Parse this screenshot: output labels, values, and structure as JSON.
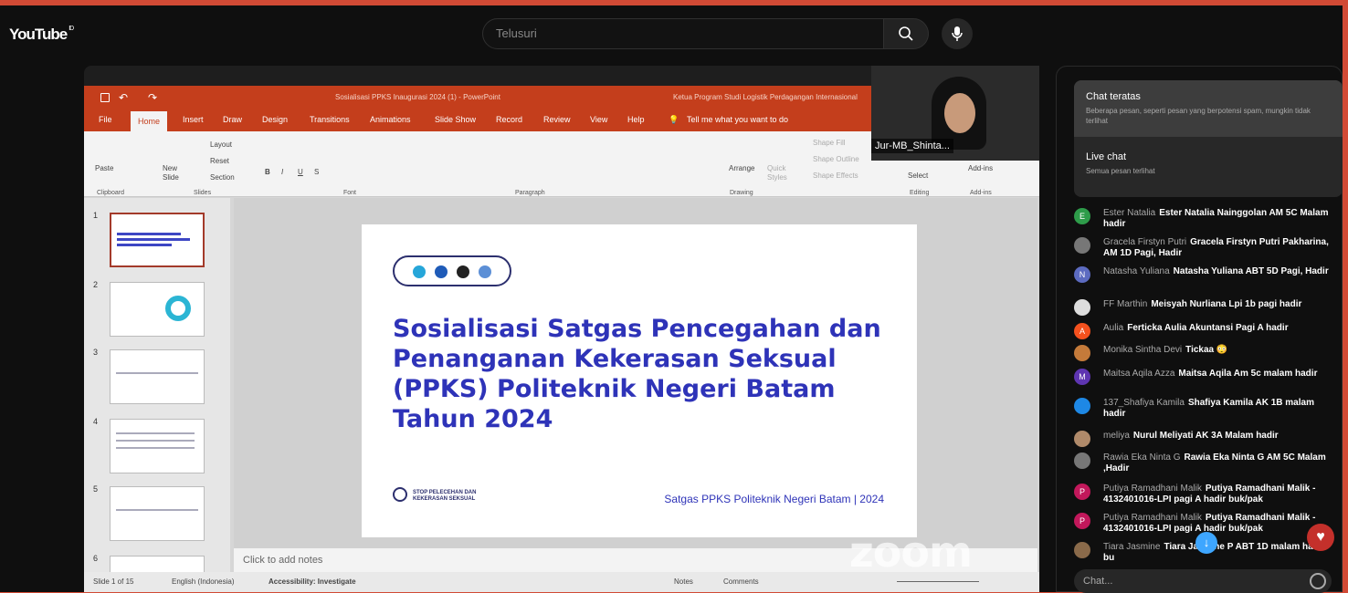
{
  "youtube": {
    "logo": "YouTube",
    "logo_mark": "ID",
    "search_placeholder": "Telusuri"
  },
  "ppt": {
    "title_doc": "Sosialisasi PPKS Inaugurasi 2024 (1)  -  PowerPoint",
    "title_user": "Ketua Program Studi Logistik Perdagangan Internasional",
    "tabs": [
      "File",
      "Home",
      "Insert",
      "Draw",
      "Design",
      "Transitions",
      "Animations",
      "Slide Show",
      "Record",
      "Review",
      "View",
      "Help"
    ],
    "tell_me": "Tell me what you want to do",
    "ribbon": {
      "clipboard": "Clipboard",
      "paste": "Paste",
      "slides": "Slides",
      "new_slide": "New Slide",
      "layout": "Layout",
      "reset": "Reset",
      "section": "Section",
      "font": "Font",
      "paragraph": "Paragraph",
      "drawing": "Drawing",
      "arrange": "Arrange",
      "quick_styles": "Quick Styles",
      "shape_fill": "Shape Fill",
      "shape_outline": "Shape Outline",
      "shape_effects": "Shape Effects",
      "editing": "Editing",
      "select": "Select",
      "addins": "Add-ins",
      "addins2": "Add-ins"
    },
    "thumb_numbers": [
      "1",
      "2",
      "3",
      "4",
      "5",
      "6"
    ],
    "slide": {
      "title": "Sosialisasi Satgas Pencegahan dan Penanganan Kekerasan Seksual (PPKS) Politeknik Negeri Batam Tahun 2024",
      "logo_text": "STOP PELECEHAN DAN KEKERASAN SEKSUAL",
      "footer": "Satgas PPKS Politeknik Negeri Batam | 2024"
    },
    "notes_placeholder": "Click to add notes",
    "status": {
      "slide_of": "Slide 1 of 15",
      "language": "English (Indonesia)",
      "accessibility": "Accessibility: Investigate",
      "notes": "Notes",
      "comments": "Comments"
    }
  },
  "camera": {
    "name": "Jur-MB_Shinta..."
  },
  "zoom_watermark": "zoom",
  "chat": {
    "menu": [
      {
        "title": "Chat teratas",
        "subtitle": "Beberapa pesan, seperti pesan yang berpotensi spam, mungkin tidak terlihat"
      },
      {
        "title": "Live chat",
        "subtitle": "Semua pesan terlihat"
      }
    ],
    "messages": [
      {
        "author": "Ester Natalia",
        "text": "Ester Natalia Nainggolan AM 5C Malam hadir",
        "avatar": "E",
        "color": "#2e9c4a"
      },
      {
        "author": "Gracela Firstyn Putri",
        "text": "Gracela Firstyn Putri Pakharina, AM 1D Pagi, Hadir",
        "avatar": "",
        "color": "#777"
      },
      {
        "author": "Natasha Yuliana",
        "text": "Natasha Yuliana ABT 5D Pagi, Hadir",
        "avatar": "N",
        "color": "#5c6bc0"
      },
      {
        "author": "FF Marthin",
        "text": "Meisyah Nurliana Lpi 1b pagi hadir",
        "avatar": "",
        "color": "#ddd"
      },
      {
        "author": "Aulia",
        "text": "Ferticka Aulia Akuntansi Pagi A hadir",
        "avatar": "A",
        "color": "#f4511e"
      },
      {
        "author": "Monika Sintha Devi",
        "text": "Tickaa 😳",
        "avatar": "",
        "color": "#c47a3a"
      },
      {
        "author": "Maitsa Aqila Azza",
        "text": "Maitsa Aqila Am 5c malam hadir",
        "avatar": "M",
        "color": "#5e35b1"
      },
      {
        "author": "137_Shafiya Kamila",
        "text": "Shafiya Kamila AK 1B malam hadir",
        "avatar": "",
        "color": "#1e88e5"
      },
      {
        "author": "meliya",
        "text": "Nurul Meliyati AK 3A Malam hadir",
        "avatar": "",
        "color": "#b08a6a"
      },
      {
        "author": "Rawia Eka Ninta G",
        "text": "Rawia Eka Ninta G AM 5C Malam ,Hadir",
        "avatar": "",
        "color": "#777"
      },
      {
        "author": "Putiya Ramadhani Malik",
        "text": "Putiya Ramadhani Malik - 4132401016-LPI pagi A hadir buk/pak",
        "avatar": "P",
        "color": "#c2185b"
      },
      {
        "author": "Putiya Ramadhani Malik",
        "text": "Putiya Ramadhani Malik - 4132401016-LPI pagi A hadir buk/pak",
        "avatar": "P",
        "color": "#c2185b"
      },
      {
        "author": "Tiara Jasmine",
        "text": "Tiara Jasmine P ABT 1D malam hadir bu",
        "avatar": "",
        "color": "#8a6a4a"
      }
    ],
    "input_placeholder": "Chat..."
  }
}
